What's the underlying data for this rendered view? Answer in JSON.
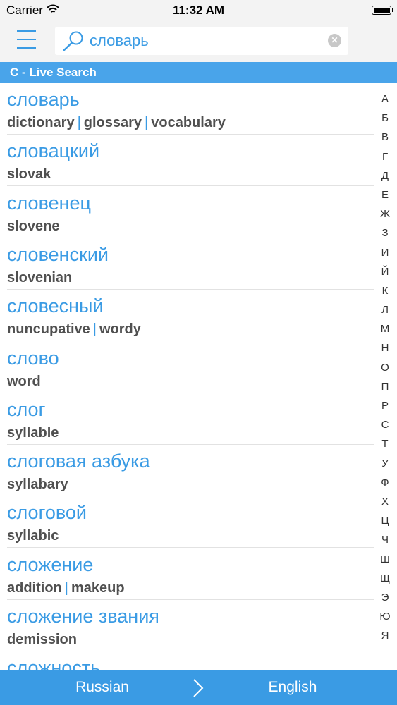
{
  "status_bar": {
    "carrier": "Carrier",
    "time": "11:32 AM"
  },
  "search": {
    "value": "словарь",
    "placeholder": ""
  },
  "section_header": "С - Live Search",
  "entries": [
    {
      "word": "словарь",
      "translations": [
        "dictionary",
        "glossary",
        "vocabulary"
      ]
    },
    {
      "word": "словацкий",
      "translations": [
        "slovak"
      ]
    },
    {
      "word": "словенец",
      "translations": [
        "slovene"
      ]
    },
    {
      "word": "словенский",
      "translations": [
        "slovenian"
      ]
    },
    {
      "word": "словесный",
      "translations": [
        "nuncupative",
        "wordy"
      ]
    },
    {
      "word": "слово",
      "translations": [
        "word"
      ]
    },
    {
      "word": "слог",
      "translations": [
        "syllable"
      ]
    },
    {
      "word": "слоговая азбука",
      "translations": [
        "syllabary"
      ]
    },
    {
      "word": "слоговой",
      "translations": [
        "syllabic"
      ]
    },
    {
      "word": "сложение",
      "translations": [
        "addition",
        "makeup"
      ]
    },
    {
      "word": "сложение звания",
      "translations": [
        "demission"
      ]
    },
    {
      "word": "сложность",
      "translations": []
    }
  ],
  "index_letters": [
    "А",
    "Б",
    "В",
    "Г",
    "Д",
    "Е",
    "Ж",
    "З",
    "И",
    "Й",
    "К",
    "Л",
    "М",
    "Н",
    "О",
    "П",
    "Р",
    "С",
    "Т",
    "У",
    "Ф",
    "Х",
    "Ц",
    "Ч",
    "Ш",
    "Щ",
    "Э",
    "Ю",
    "Я"
  ],
  "bottom_bar": {
    "source_language": "Russian",
    "target_language": "English"
  },
  "colors": {
    "accent": "#3a9be4",
    "header": "#49a4ea",
    "translation_text": "#505050",
    "bar_background": "#f3f3f3"
  }
}
